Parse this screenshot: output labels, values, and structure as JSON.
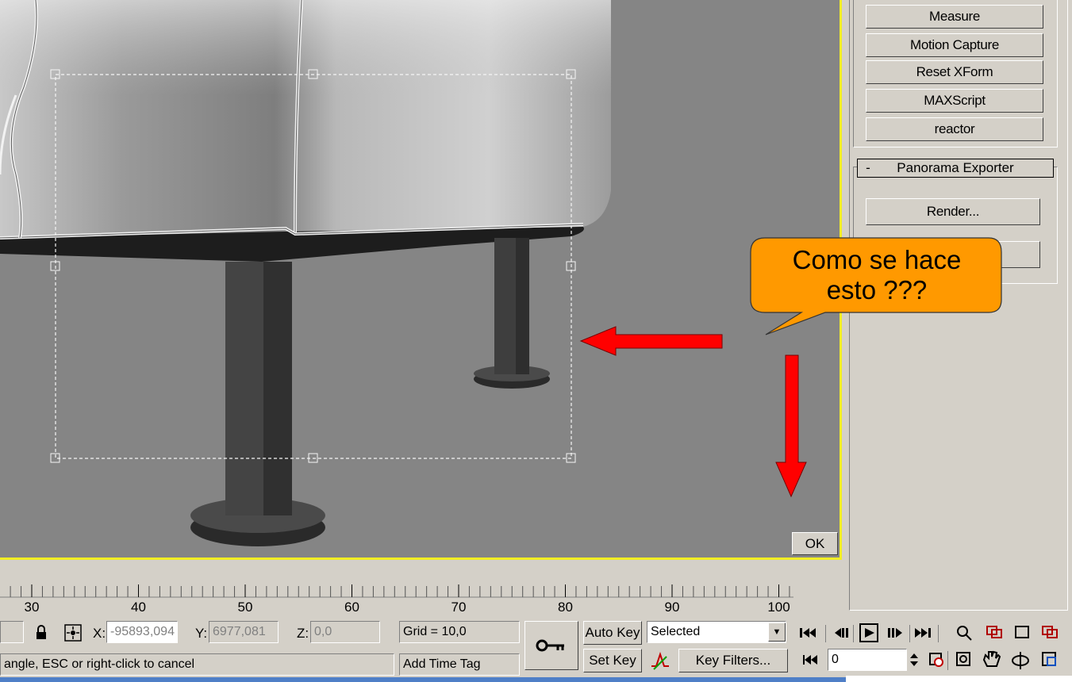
{
  "viewport": {
    "ok_label": "OK",
    "callout_line1": "Como se hace",
    "callout_line2": "esto ???"
  },
  "utilities": {
    "buttons": [
      "Measure",
      "Motion Capture",
      "Reset XForm",
      "MAXScript",
      "reactor"
    ],
    "rollout_toggle": "-",
    "rollout_title": "Panorama Exporter",
    "render_label": "Render..."
  },
  "timeline": {
    "ticks": [
      "30",
      "40",
      "50",
      "60",
      "70",
      "80",
      "90",
      "100"
    ]
  },
  "status": {
    "x_label": "X:",
    "x_value": "-95893,094",
    "y_label": "Y:",
    "y_value": "6977,081",
    "z_label": "Z:",
    "z_value": "0,0",
    "grid": "Grid = 10,0",
    "add_time_tag": "Add Time Tag",
    "prompt": "angle, ESC or right-click to cancel",
    "auto_key": "Auto Key",
    "set_key": "Set Key",
    "key_mode": "Selected",
    "key_filters": "Key Filters...",
    "frame": "0"
  },
  "colors": {
    "viewport_bg": "#858585",
    "active_border": "#f2ee24",
    "callout_fill": "#ff9900",
    "arrow_red": "#ff0000"
  }
}
